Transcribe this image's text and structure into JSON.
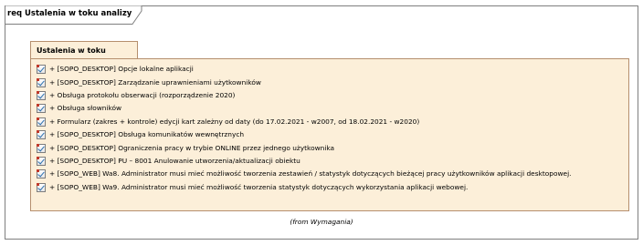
{
  "frame": {
    "title": "req Ustalenia w toku analizy"
  },
  "package": {
    "name": "Ustalenia w toku analizy",
    "requirements": [
      "+ [SOPO_DESKTOP] Opcje lokalne aplikacji",
      "+ [SOPO_DESKTOP] Zarządzanie uprawnieniami użytkowników",
      "+ Obsługa protokołu obserwacji (rozporządzenie 2020)",
      "+ Obsługa słowników",
      "+ Formularz (zakres + kontrole) edycji kart zależny od daty (do 17.02.2021 - w2007, od 18.02.2021 - w2020)",
      "+ [SOPO_DESKTOP] Obsługa komunikatów wewnętrznych",
      "+ [SOPO_DESKTOP] Ograniczenia pracy w trybie ONLINE przez jednego użytkownika",
      "+ [SOPO_DESKTOP] PU – 8001 Anulowanie utworzenia/aktualizacji obiektu",
      "+ [SOPO_WEB] Wa8. Administrator musi mieć możliwość tworzenia zestawień / statystyk dotyczących bieżącej pracy użytkowników aplikacji desktopowej.",
      "+ [SOPO_WEB] Wa9. Administrator musi mieć możliwość tworzenia statystyk dotyczących wykorzystania aplikacji webowej."
    ],
    "from_note": "(from Wymagania)"
  },
  "icons": {
    "requirement": "requirement-icon"
  }
}
